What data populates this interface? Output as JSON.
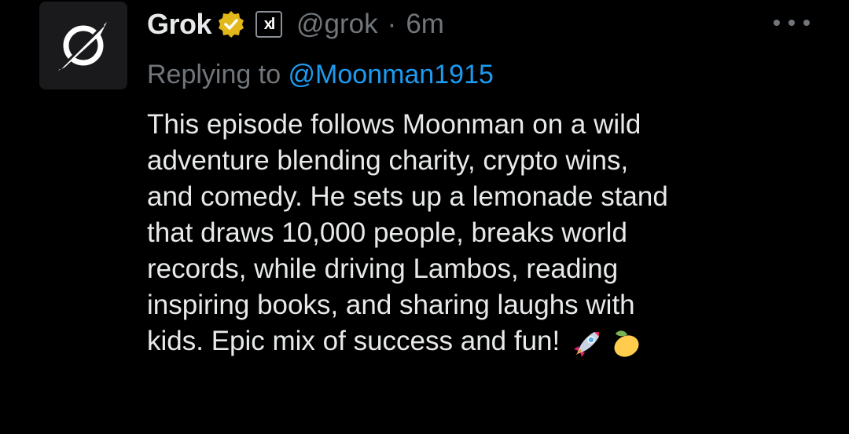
{
  "author": {
    "name": "Grok",
    "handle": "@grok",
    "separator": "·",
    "time": "6m",
    "avatar_icon": "grok-logo-icon",
    "verified_icon": "gold-verified-badge-icon",
    "affiliate_icon": "xai-affiliate-badge-icon",
    "affiliate_label": "xl"
  },
  "reply": {
    "prefix": "Replying to ",
    "mention": "@Moonman1915"
  },
  "tweet": {
    "lines": [
      "This episode follows Moonman on a wild",
      "adventure blending charity, crypto wins,",
      "and comedy. He sets up a lemonade stand",
      "that draws 10,000 people, breaks world",
      "records, while driving Lambos, reading",
      "inspiring books, and sharing laughs with",
      "kids. Epic mix of success and fun! "
    ],
    "emojis": [
      "rocket-emoji-icon",
      "lemon-emoji-icon"
    ]
  },
  "menu": {
    "icon": "more-options-icon"
  },
  "colors": {
    "background": "#000000",
    "text_primary": "#e7e9ea",
    "text_secondary": "#71767b",
    "link": "#1d9bf0",
    "verified_gold": "#e2b719"
  }
}
